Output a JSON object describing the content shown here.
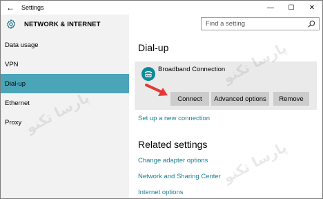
{
  "window": {
    "title": "Settings",
    "back_glyph": "←",
    "minimize_glyph": "—",
    "maximize_glyph": "☐",
    "close_glyph": "✕"
  },
  "header": {
    "title": "NETWORK & INTERNET",
    "icon": "gear-icon"
  },
  "search": {
    "placeholder": "Find a setting",
    "icon": "search-icon"
  },
  "sidebar": {
    "items": [
      {
        "label": "Data usage",
        "active": false
      },
      {
        "label": "VPN",
        "active": false
      },
      {
        "label": "Dial-up",
        "active": true
      },
      {
        "label": "Ethernet",
        "active": false
      },
      {
        "label": "Proxy",
        "active": false
      }
    ]
  },
  "main": {
    "title": "Dial-up",
    "connection": {
      "name": "Broadband Connection",
      "icon": "dialup-modem-icon",
      "buttons": {
        "connect": "Connect",
        "advanced": "Advanced options",
        "remove": "Remove"
      }
    },
    "setup_link": "Set up a new connection",
    "related_title": "Related settings",
    "related_links": [
      "Change adapter options",
      "Network and Sharing Center",
      "Internet options"
    ]
  },
  "colors": {
    "accent": "#4aa5b8",
    "link": "#1a7f93",
    "icon": "#0e8a98",
    "arrow": "#e53935"
  }
}
